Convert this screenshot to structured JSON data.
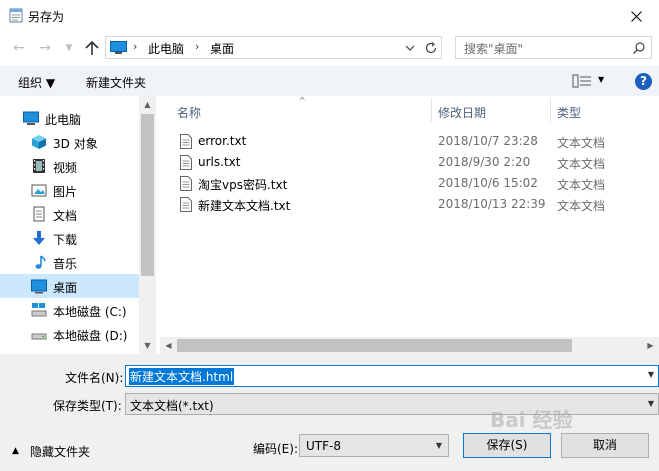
{
  "window": {
    "title": "另存为"
  },
  "address": {
    "crumbs": [
      "此电脑",
      "桌面"
    ],
    "sep": "›"
  },
  "search": {
    "placeholder": "搜索\"桌面\""
  },
  "toolbar": {
    "organize": "组织 ▼",
    "new_folder": "新建文件夹"
  },
  "help": "?",
  "sidebar": {
    "items": [
      {
        "label": "此电脑",
        "icon": "computer-icon"
      },
      {
        "label": "3D 对象",
        "icon": "cube-icon"
      },
      {
        "label": "视频",
        "icon": "film-icon"
      },
      {
        "label": "图片",
        "icon": "picture-icon"
      },
      {
        "label": "文档",
        "icon": "document-icon"
      },
      {
        "label": "下载",
        "icon": "download-arrow-icon"
      },
      {
        "label": "音乐",
        "icon": "music-note-icon"
      },
      {
        "label": "桌面",
        "icon": "desktop-icon",
        "selected": true
      },
      {
        "label": "本地磁盘 (C:)",
        "icon": "drive-icon"
      },
      {
        "label": "本地磁盘 (D:)",
        "icon": "drive-icon"
      }
    ]
  },
  "filelist": {
    "columns": {
      "name": "名称",
      "date": "修改日期",
      "type": "类型"
    },
    "rows": [
      {
        "name": "error.txt",
        "date": "2018/10/7 23:28",
        "type": "文本文档"
      },
      {
        "name": "urls.txt",
        "date": "2018/9/30 2:20",
        "type": "文本文档"
      },
      {
        "name": "淘宝vps密码.txt",
        "date": "2018/10/6 15:02",
        "type": "文本文档"
      },
      {
        "name": "新建文本文档.txt",
        "date": "2018/10/13 22:39",
        "type": "文本文档"
      }
    ]
  },
  "form": {
    "filename_label": "文件名(N):",
    "filename_value": "新建文本文档.html",
    "savetype_label": "保存类型(T):",
    "savetype_value": "文本文档(*.txt)",
    "hide_folders": "隐藏文件夹",
    "encoding_label": "编码(E):",
    "encoding_value": "UTF-8",
    "save_button": "保存(S)",
    "cancel_button": "取消"
  },
  "watermark": "Bai 经验",
  "colors": {
    "accent": "#0078d7",
    "selected": "#cce8ff",
    "help": "#1b5fbf",
    "header_text": "#4c607a"
  }
}
